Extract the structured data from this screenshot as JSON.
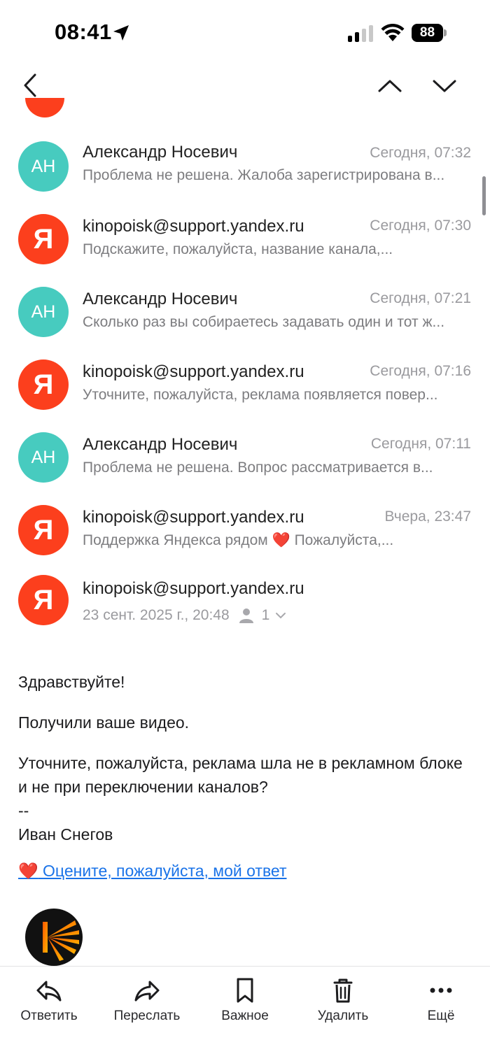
{
  "status_bar": {
    "time": "08:41",
    "battery": "88"
  },
  "threads": [
    {
      "initials": "АН",
      "sender": "Александр Носевич",
      "time": "Сегодня, 07:32",
      "snippet": "Проблема не решена. Жалоба зарегистрирована в..."
    },
    {
      "initials": "Я",
      "sender": "kinopoisk@support.yandex.ru",
      "time": "Сегодня, 07:30",
      "snippet": "Подскажите, пожалуйста, название канала,..."
    },
    {
      "initials": "АН",
      "sender": "Александр Носевич",
      "time": "Сегодня, 07:21",
      "snippet": "Сколько раз вы собираетесь задавать один и тот ж..."
    },
    {
      "initials": "Я",
      "sender": "kinopoisk@support.yandex.ru",
      "time": "Сегодня, 07:16",
      "snippet": "Уточните, пожалуйста, реклама появляется повер..."
    },
    {
      "initials": "АН",
      "sender": "Александр Носевич",
      "time": "Сегодня, 07:11",
      "snippet": "Проблема не решена. Вопрос рассматривается в..."
    },
    {
      "initials": "Я",
      "sender": "kinopoisk@support.yandex.ru",
      "time": "Вчера, 23:47",
      "snippet_before": "Поддержка Яндекса рядом",
      "snippet_heart": "❤️",
      "snippet_after": "Пожалуйста,..."
    }
  ],
  "open_message": {
    "initials": "Я",
    "sender": "kinopoisk@support.yandex.ru",
    "date": "23 сент. 2025 г., 20:48",
    "recipients_count": "1",
    "greeting": "Здравствуйте!",
    "line1": "Получили ваше видео.",
    "line2": "Уточните, пожалуйста, реклама шла не в рекламном блоке и не при переключении каналов?",
    "separator": "--",
    "signature": "Иван Снегов",
    "rate_heart": "❤️",
    "rate_link": "Оцените, пожалуйста, мой ответ"
  },
  "toolbar": {
    "reply": "Ответить",
    "forward": "Переслать",
    "important": "Важное",
    "delete": "Удалить",
    "more": "Ещё"
  },
  "colors": {
    "teal_avatar": "#47cbbf",
    "yandex_red": "#fc3f1d",
    "link": "#1a73e8"
  }
}
